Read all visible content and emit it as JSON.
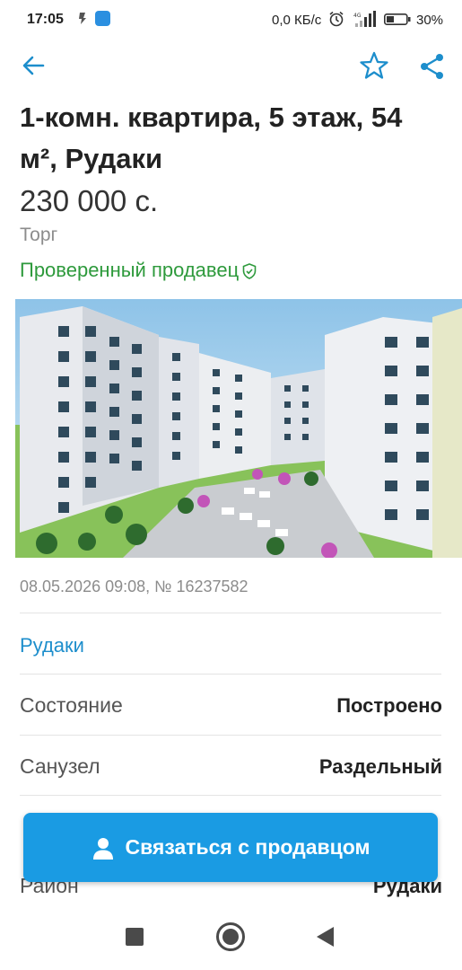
{
  "status_bar": {
    "time": "17:05",
    "net_speed": "0,0 КБ/с",
    "battery": "30%"
  },
  "app_bar": {
    "icons": [
      "back-arrow-icon",
      "star-outline-icon",
      "share-icon"
    ],
    "accent_color": "#1d8ecc"
  },
  "listing": {
    "title": "1-комн. квартира, 5 этаж, 54 м², Рудаки",
    "price": "230 000 с.",
    "bargain": "Торг",
    "verified": "Проверенный продавец",
    "meta": "08.05.2026 09:08, № 16237582",
    "location": "Рудаки"
  },
  "details": [
    {
      "label": "Состояние",
      "value": "Построено"
    },
    {
      "label": "Санузел",
      "value": "Раздельный"
    },
    {
      "label": "Район",
      "value": "Рудаки"
    }
  ],
  "contact_button": {
    "label": "Связаться с продавцом",
    "color": "#1a9be3"
  },
  "colors": {
    "verified_green": "#2e9a3c",
    "link_blue": "#1d8ecc"
  }
}
